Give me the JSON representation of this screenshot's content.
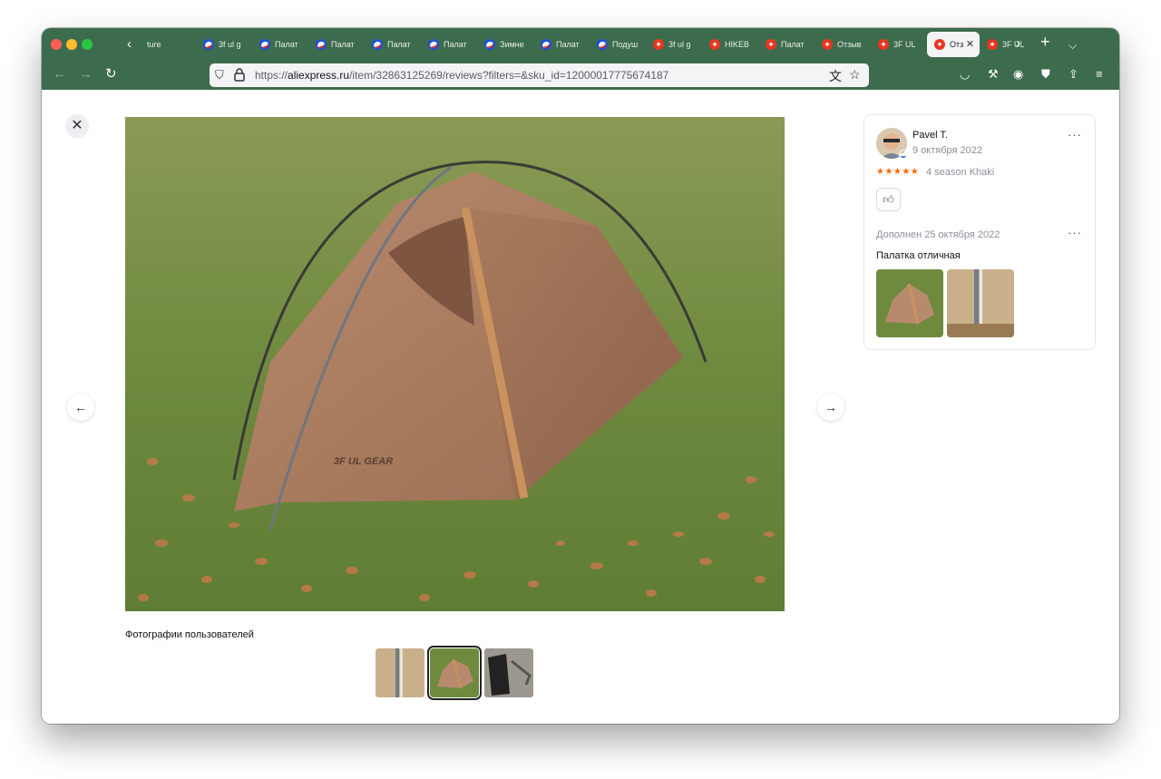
{
  "browser": {
    "tabs": [
      {
        "label": "ture",
        "favicon": "globe"
      },
      {
        "label": "3f ul g",
        "favicon": "blue-brand-icon"
      },
      {
        "label": "Палат",
        "favicon": "blue-brand-icon"
      },
      {
        "label": "Палат",
        "favicon": "blue-brand-icon"
      },
      {
        "label": "Палат",
        "favicon": "blue-brand-icon"
      },
      {
        "label": "Палат",
        "favicon": "blue-brand-icon"
      },
      {
        "label": "Зимне",
        "favicon": "blue-brand-icon"
      },
      {
        "label": "Палат",
        "favicon": "blue-brand-icon"
      },
      {
        "label": "Подуш",
        "favicon": "blue-brand-icon"
      },
      {
        "label": "3f ul g",
        "favicon": "aliexpress-icon"
      },
      {
        "label": "HIKEB",
        "favicon": "aliexpress-icon"
      },
      {
        "label": "Палат",
        "favicon": "aliexpress-icon"
      },
      {
        "label": "Отзыв",
        "favicon": "aliexpress-icon"
      },
      {
        "label": "3F UL",
        "favicon": "aliexpress-icon"
      },
      {
        "label": "Отз",
        "favicon": "aliexpress-icon",
        "active": true
      },
      {
        "label": "3F UL",
        "favicon": "aliexpress-icon"
      }
    ],
    "url_prefix": "https://",
    "url_domain": "aliexpress.ru",
    "url_path": "/item/32863125269/reviews?filters=&sku_id=12000017775674187",
    "theme_color": "#3d6b4d"
  },
  "viewer": {
    "photos_caption": "Фотографии пользователей",
    "tent_logo_text": "3F UL GEAR"
  },
  "review": {
    "user_name": "Pavel T.",
    "date": "9 октября 2022",
    "stars": "★★★★★",
    "rating": 5,
    "variant": "4 season Khaki",
    "added_date": "Дополнен 25 октября 2022",
    "text": "Палатка отличная",
    "star_color": "#ff6a00"
  }
}
